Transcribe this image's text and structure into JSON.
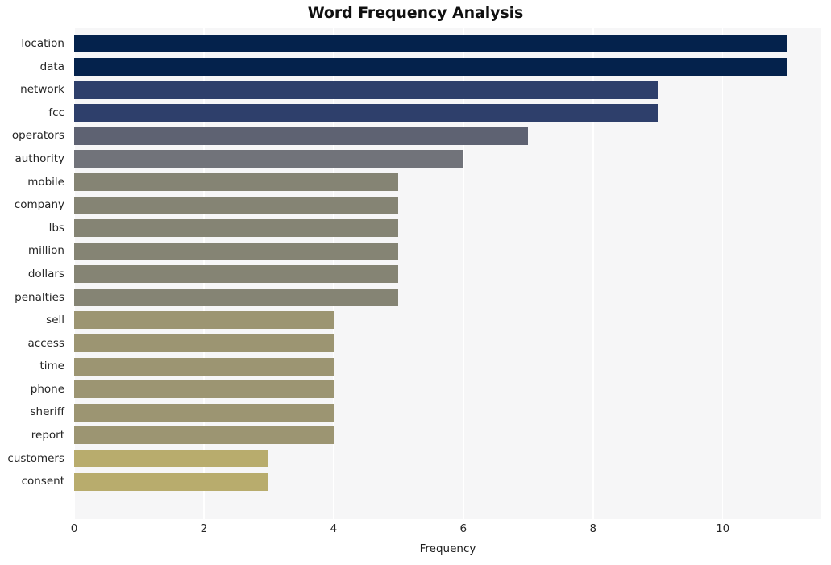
{
  "chart_data": {
    "type": "bar",
    "orientation": "horizontal",
    "title": "Word Frequency Analysis",
    "xlabel": "Frequency",
    "ylabel": "",
    "categories": [
      "location",
      "data",
      "network",
      "fcc",
      "operators",
      "authority",
      "mobile",
      "company",
      "lbs",
      "million",
      "dollars",
      "penalties",
      "sell",
      "access",
      "time",
      "phone",
      "sheriff",
      "report",
      "customers",
      "consent"
    ],
    "values": [
      11,
      11,
      9,
      9,
      7,
      6,
      5,
      5,
      5,
      5,
      5,
      5,
      4,
      4,
      4,
      4,
      4,
      4,
      3,
      3
    ],
    "bar_colors": [
      "#04224c",
      "#04224c",
      "#2e3f6b",
      "#2e3f6b",
      "#5e6272",
      "#71737a",
      "#858474",
      "#858474",
      "#858474",
      "#858474",
      "#858474",
      "#858474",
      "#9c9572",
      "#9c9572",
      "#9c9572",
      "#9c9572",
      "#9c9572",
      "#9c9572",
      "#b8ac6d",
      "#b8ac6d"
    ],
    "xlim": [
      0,
      11.52
    ],
    "xticks": [
      0,
      2,
      4,
      6,
      8,
      10
    ],
    "xtick_labels": [
      "0",
      "2",
      "4",
      "6",
      "8",
      "10"
    ],
    "grid": true,
    "grid_axis": "x",
    "legend": false,
    "plot_background": "#f6f6f7",
    "figure_background": "#ffffff"
  }
}
